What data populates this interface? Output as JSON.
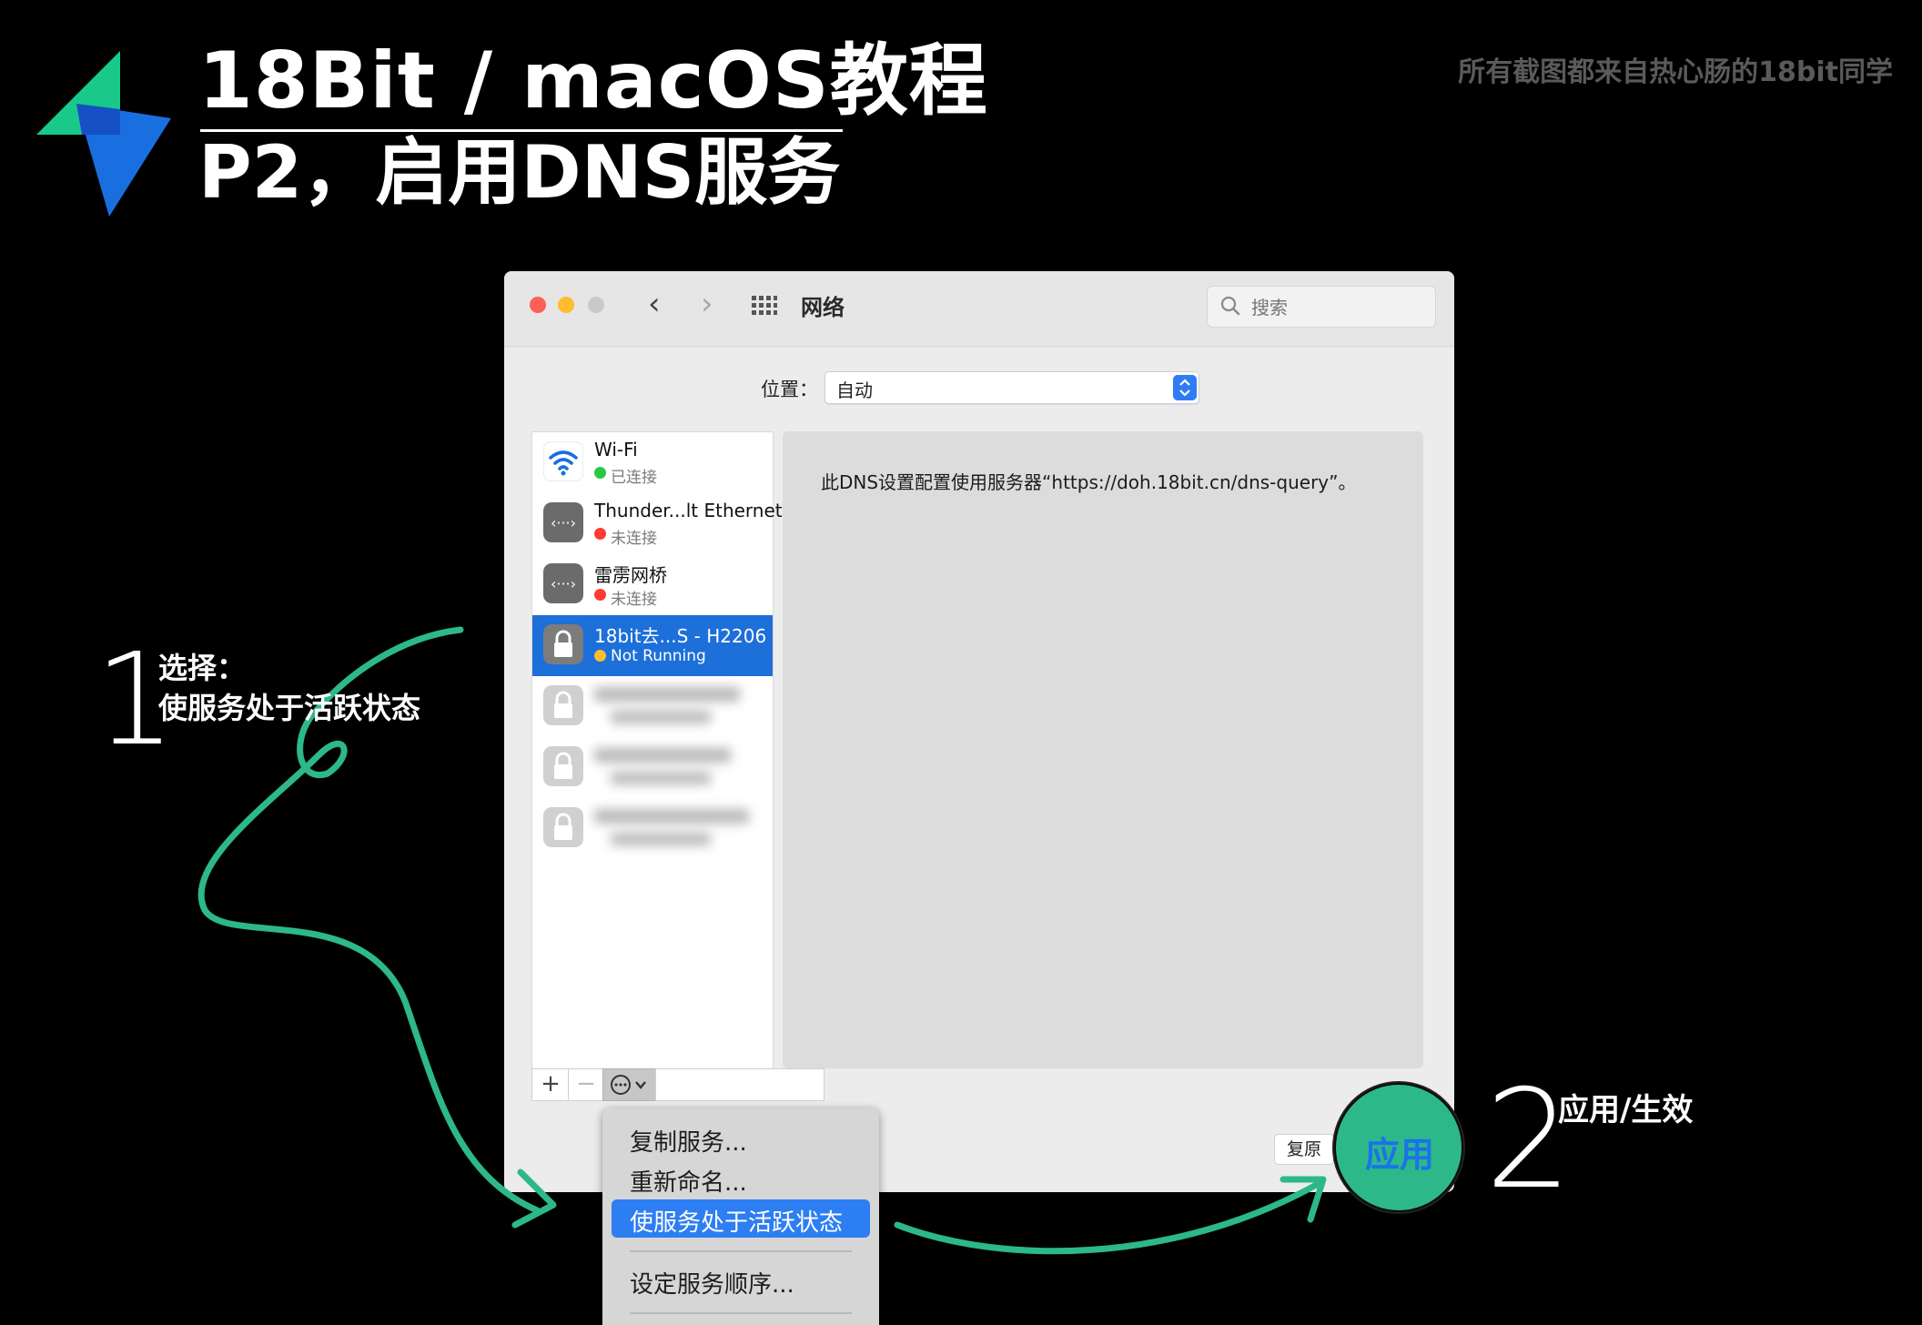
{
  "header": {
    "title": "18Bit / macOS教程",
    "subtitle": "P2，启用DNS服务",
    "credit": "所有截图都来自热心肠的18bit同学"
  },
  "window": {
    "title": "网络",
    "search_placeholder": "搜索",
    "location_label": "位置：",
    "location_value": "自动",
    "detail_text": "此DNS设置配置使用服务器“https://doh.18bit.cn/dns-query”。",
    "revert_button": "复原",
    "apply_button": "应用"
  },
  "sidebar": {
    "add_label": "+",
    "remove_label": "−",
    "services": [
      {
        "name": "Wi-Fi",
        "status": "已连接",
        "status_color": "#28c840",
        "icon": "wifi-icon"
      },
      {
        "name": "Thunder...lt Ethernet",
        "status": "未连接",
        "status_color": "#fe3b30",
        "icon": "ethernet-icon"
      },
      {
        "name": "雷雳网桥",
        "status": "未连接",
        "status_color": "#fe3b30",
        "icon": "ethernet-icon"
      },
      {
        "name": "18bit去...S - H2206",
        "status": "Not Running",
        "status_color": "#ffbd2e",
        "icon": "lock-icon"
      }
    ]
  },
  "menu": {
    "items": [
      "复制服务...",
      "重新命名...",
      "使服务处于活跃状态",
      "设定服务顺序..."
    ]
  },
  "annotations": {
    "step1_number": "1",
    "step1_text_line1": "选择：",
    "step1_text_line2": "使服务处于活跃状态",
    "step2_number": "2",
    "step2_text": "应用/生效"
  },
  "colors": {
    "accent": "#2db889",
    "selection": "#1d6fd9",
    "menu_highlight": "#2d7ef3"
  }
}
